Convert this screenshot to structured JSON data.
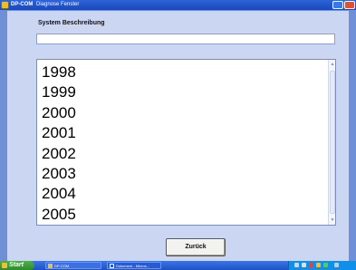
{
  "window": {
    "app_name": "DP-COM",
    "title": "Diagnose Fenster"
  },
  "content": {
    "section_label": "System Beschreibung",
    "description_value": "",
    "years": [
      "1998",
      "1999",
      "2000",
      "2001",
      "2002",
      "2003",
      "2004",
      "2005"
    ],
    "back_label": "Zurück"
  },
  "taskbar": {
    "start_label": "Start",
    "tasks": [
      {
        "label": "DP-COM"
      },
      {
        "label": "Dokument - Micros..."
      }
    ]
  },
  "colors": {
    "window_bg": "#6f8fd6",
    "content_bg": "#cbd6f2",
    "titlebar": "#1b48b8",
    "taskbar": "#2a5fd6",
    "start_button": "#3a9a36"
  }
}
